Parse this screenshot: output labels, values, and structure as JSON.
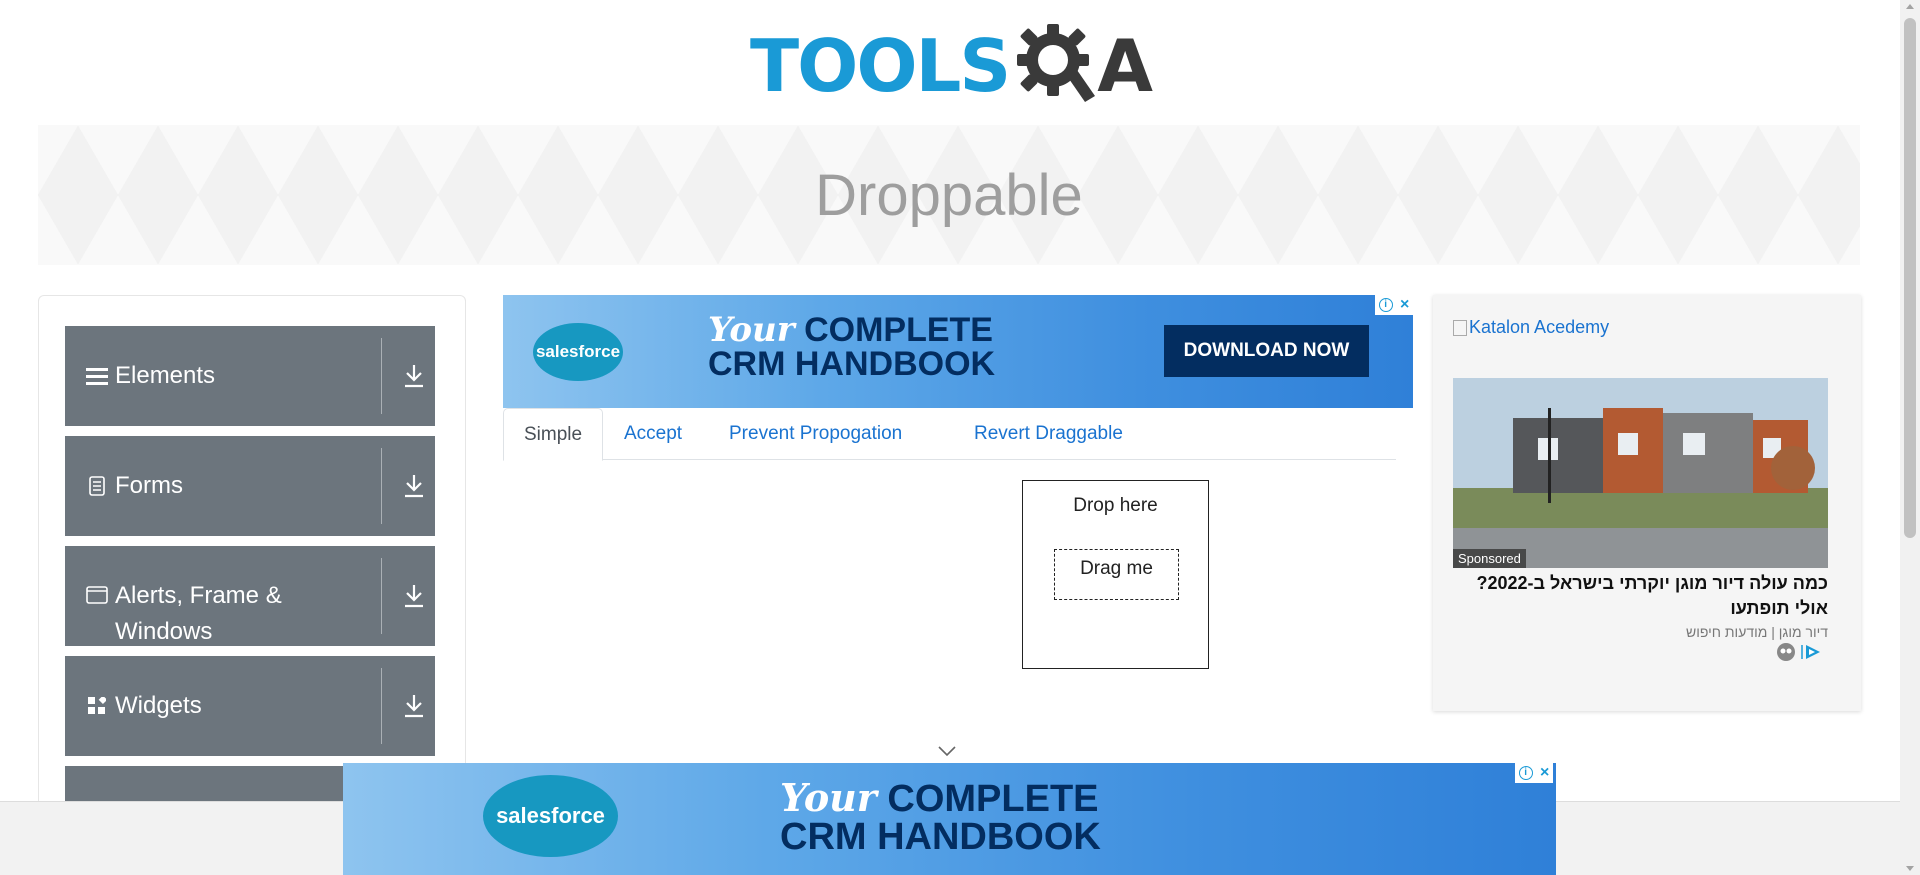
{
  "header": {
    "logo_left": "TOOLS",
    "logo_right": "A"
  },
  "banner": {
    "title": "Droppable"
  },
  "sidebar": {
    "groups": [
      {
        "label": "Elements",
        "icon": "hamburger-icon"
      },
      {
        "label": "Forms",
        "icon": "document-icon"
      },
      {
        "label": "Alerts, Frame & Windows",
        "icon": "window-icon"
      },
      {
        "label": "Widgets",
        "icon": "widgets-icon"
      }
    ]
  },
  "ad_top": {
    "brand": "salesforce",
    "headline_italic": "Your",
    "headline_line1": "COMPLETE",
    "headline_line2": "CRM HANDBOOK",
    "cta": "DOWNLOAD NOW"
  },
  "tabs": {
    "items": [
      "Simple",
      "Accept",
      "Prevent Propogation",
      "Revert Draggable"
    ],
    "active": "Simple"
  },
  "droppable": {
    "drop_label": "Drop here",
    "drag_label": "Drag me"
  },
  "right_ad": {
    "link_text": "Katalon Acedemy",
    "sponsored": "Sponsored",
    "title": "כמה עולה דיור מוגן יוקרתי בישראל ב-2022? אולי תופתעו",
    "subtitle": "דיור מוגן | מודעות חיפוש"
  },
  "ad_bottom": {
    "brand": "salesforce",
    "headline_italic": "Your",
    "headline_line1": "COMPLETE",
    "headline_line2": "CRM HANDBOOK"
  },
  "colors": {
    "logo_blue": "#1a9ad6",
    "logo_dark": "#3a3a3a",
    "sidebar_group_bg": "#6c757d",
    "tab_link": "#1a73d0",
    "ad_navy": "#032d60"
  }
}
